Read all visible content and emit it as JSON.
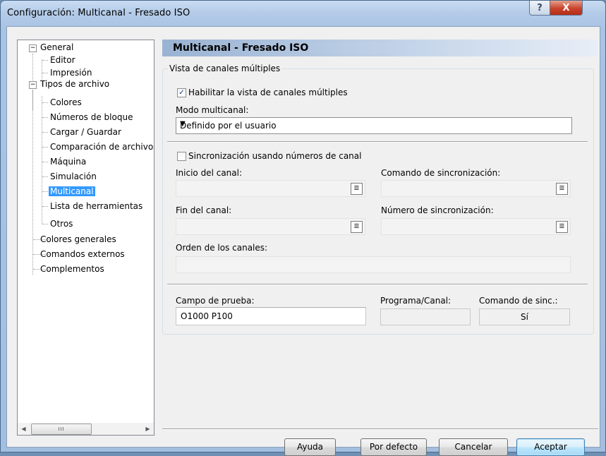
{
  "window": {
    "title": "Configuración: Multicanal - Fresado ISO",
    "help_glyph": "?",
    "close_glyph": "X"
  },
  "tree": {
    "items": [
      {
        "label": "General",
        "toggle": "−"
      },
      {
        "label": "Editor"
      },
      {
        "label": "Impresión"
      },
      {
        "label": "Tipos de archivo",
        "toggle": "−"
      },
      {
        "label": "Colores"
      },
      {
        "label": "Números de bloque"
      },
      {
        "label": "Cargar / Guardar"
      },
      {
        "label": "Comparación de archivos"
      },
      {
        "label": "Máquina"
      },
      {
        "label": "Simulación"
      },
      {
        "label": "Multicanal",
        "selected": true
      },
      {
        "label": "Lista de herramientas"
      },
      {
        "label": "Otros"
      },
      {
        "label": "Colores generales"
      },
      {
        "label": "Comandos externos"
      },
      {
        "label": "Complementos"
      }
    ],
    "scroll_left": "◀",
    "scroll_right": "▶",
    "thumb_grip": "III"
  },
  "page": {
    "header": "Multicanal - Fresado ISO",
    "group_label": "Vista de canales múltiples",
    "enable_multichannel": {
      "label": "Habilitar la vista de canales múltiples",
      "checked": true,
      "mark": "✓"
    },
    "mode_label": "Modo multicanal:",
    "mode_value": "Definido por el usuario",
    "sync_channel_numbers": {
      "label": "Sincronización usando números de canal",
      "checked": false
    },
    "channel_start_label": "Inicio del canal:",
    "sync_command_label": "Comando de sincronización:",
    "channel_end_label": "Fin del canal:",
    "sync_number_label": "Número de sincronización:",
    "channel_order_label": "Orden de los canales:",
    "test_field_label": "Campo de prueba:",
    "test_field_value": "O1000 P100",
    "program_channel_label": "Programa/Canal:",
    "sync_command_result_label": "Comando de sinc.:",
    "sync_command_result_value": "Sí"
  },
  "buttons": {
    "help": "Ayuda",
    "defaults": "Por defecto",
    "cancel": "Cancelar",
    "accept": "Aceptar"
  },
  "icons": {
    "combo_arrow": "▼",
    "field_button": "≣"
  }
}
